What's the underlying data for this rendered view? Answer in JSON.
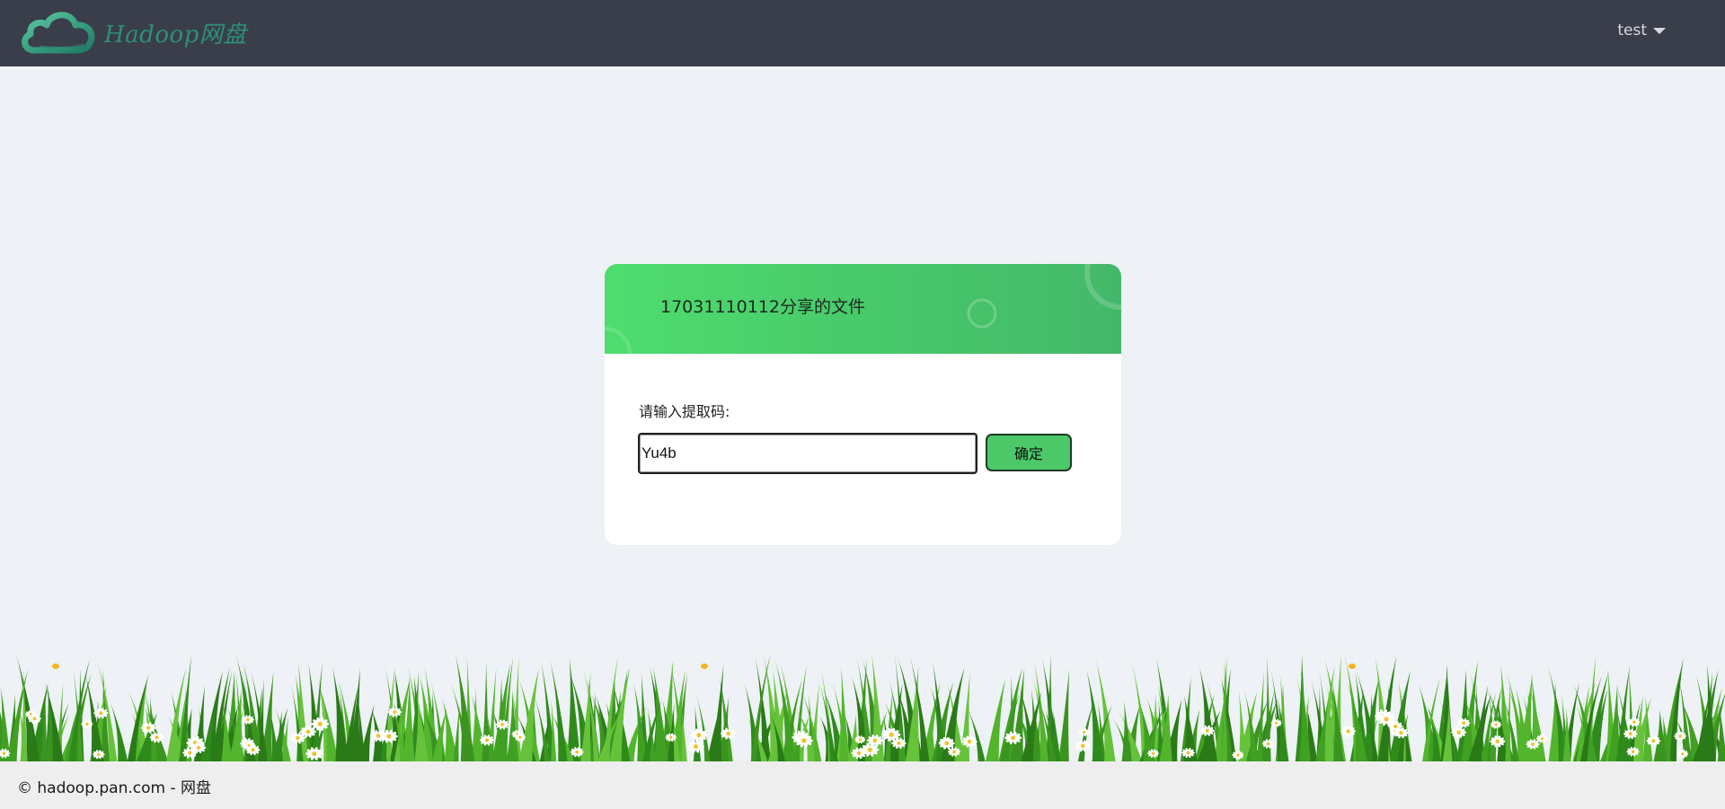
{
  "header": {
    "logo_text": "Hadoop网盘",
    "user_name": "test"
  },
  "share_card": {
    "title": "17031110112分享的文件",
    "prompt_label": "请输入提取码:",
    "code_input_value": "Yu4b",
    "confirm_label": "确定"
  },
  "footer": {
    "copyright": "© hadoop.pan.com - 网盘"
  },
  "colors": {
    "topbar": "#393e4a",
    "accent_green": "#4cc868",
    "logo_teal": "#2e8f78",
    "page_background": "#eef1f5"
  },
  "icons": {
    "logo": "cloud-icon",
    "user_menu": "caret-down-icon"
  }
}
